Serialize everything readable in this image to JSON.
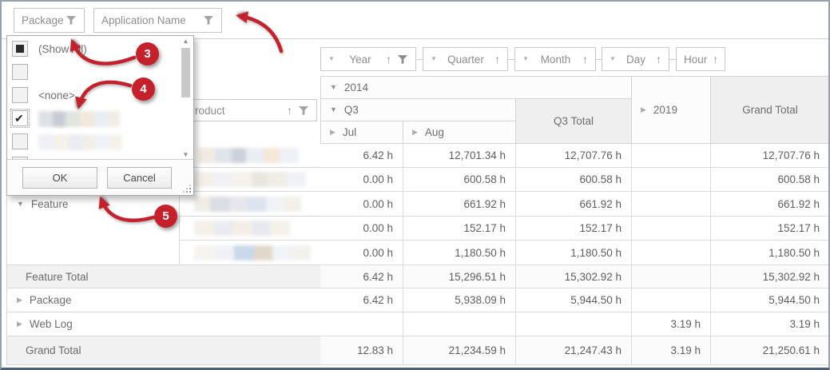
{
  "filter_area": {
    "fields": [
      {
        "label": "Package"
      },
      {
        "label": "Application Name"
      }
    ]
  },
  "filter_popup": {
    "items": [
      {
        "label": "(Show All)",
        "state": "partial"
      },
      {
        "label": "",
        "state": "unchecked"
      },
      {
        "label": "<none>",
        "state": "unchecked"
      },
      {
        "label": "",
        "state": "checked",
        "redacted": true
      },
      {
        "label": "",
        "state": "unchecked",
        "redacted": true
      },
      {
        "label": "",
        "state": "unchecked"
      }
    ],
    "ok_label": "OK",
    "cancel_label": "Cancel"
  },
  "annotations": {
    "badges": [
      {
        "n": "3"
      },
      {
        "n": "4"
      },
      {
        "n": "5"
      }
    ],
    "accent_red": "#c4212c"
  },
  "pivot": {
    "column_fields": {
      "year": "Year",
      "quarter": "Quarter",
      "month": "Month",
      "day": "Day",
      "hour": "Hour"
    },
    "row_field": {
      "label": "Product"
    },
    "column_headers": {
      "y2014": "2014",
      "q3": "Q3",
      "jul": "Jul",
      "aug": "Aug",
      "q3_total": "Q3 Total",
      "y2019": "2019",
      "grand_total": "Grand Total"
    },
    "row_headers": {
      "feature": "Feature",
      "feature_total": "Feature Total",
      "package": "Package",
      "web_log": "Web Log",
      "grand_total": "Grand Total"
    }
  },
  "grid": {
    "unit": "h",
    "rows": [
      [
        "6.42 h",
        "12,701.34 h",
        "12,707.76 h",
        "",
        "12,707.76 h"
      ],
      [
        "0.00 h",
        "600.58 h",
        "600.58 h",
        "",
        "600.58 h"
      ],
      [
        "0.00 h",
        "661.92 h",
        "661.92 h",
        "",
        "661.92 h"
      ],
      [
        "0.00 h",
        "152.17 h",
        "152.17 h",
        "",
        "152.17 h"
      ],
      [
        "0.00 h",
        "1,180.50 h",
        "1,180.50 h",
        "",
        "1,180.50 h"
      ],
      [
        "6.42 h",
        "15,296.51 h",
        "15,302.92 h",
        "",
        "15,302.92 h"
      ],
      [
        "6.42 h",
        "5,938.09 h",
        "5,944.50 h",
        "",
        "5,944.50 h"
      ],
      [
        "",
        "",
        "",
        "3.19 h",
        "3.19 h"
      ],
      [
        "12.83 h",
        "21,234.59 h",
        "21,247.43 h",
        "3.19 h",
        "21,250.61 h"
      ]
    ]
  }
}
